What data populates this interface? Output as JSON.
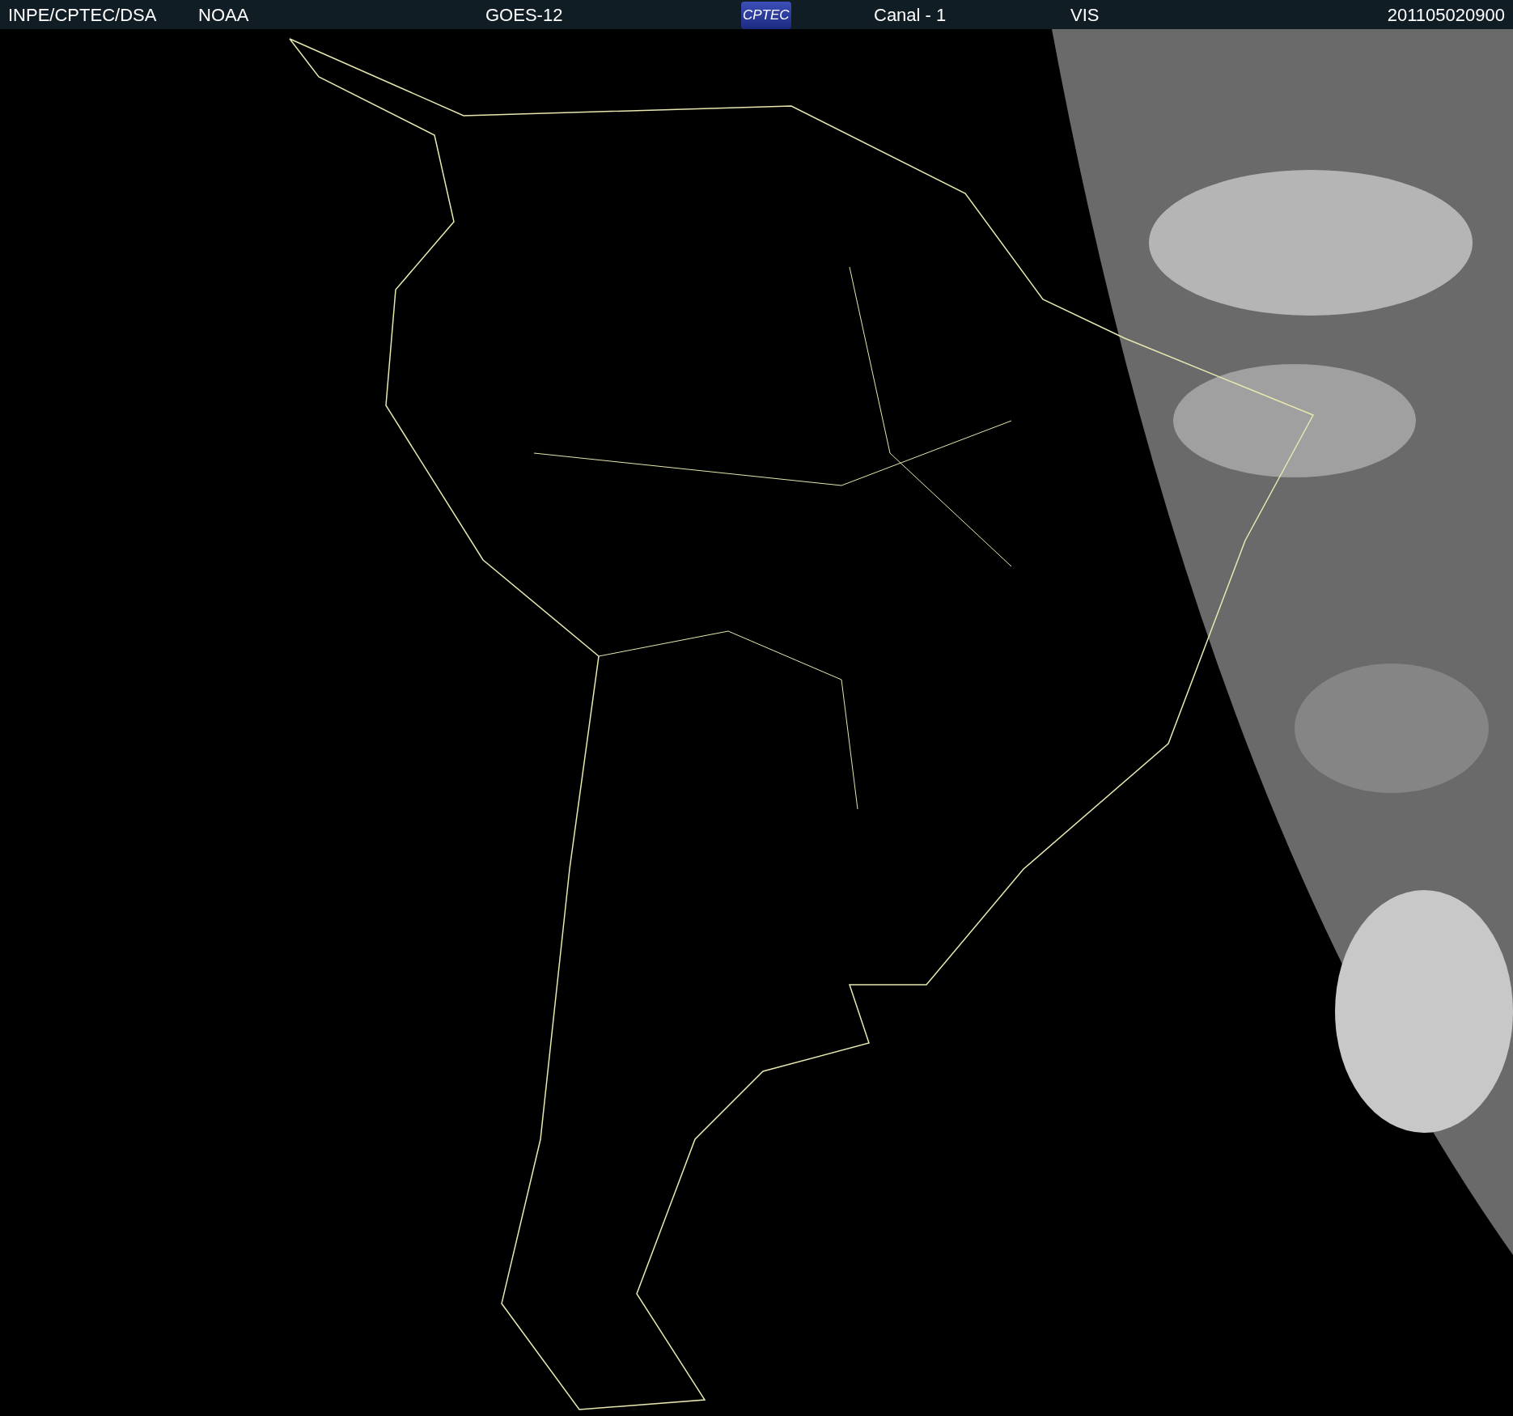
{
  "header": {
    "items": [
      {
        "kind": "text",
        "text": "INPE/CPTEC/DSA"
      },
      {
        "kind": "text",
        "text": "NOAA"
      },
      {
        "kind": "text",
        "text": "GOES-12"
      },
      {
        "kind": "logo",
        "text": "CPTEC"
      },
      {
        "kind": "text",
        "text": "Canal - 1"
      },
      {
        "kind": "text",
        "text": "VIS"
      },
      {
        "kind": "date",
        "text": "201105020900"
      }
    ]
  }
}
